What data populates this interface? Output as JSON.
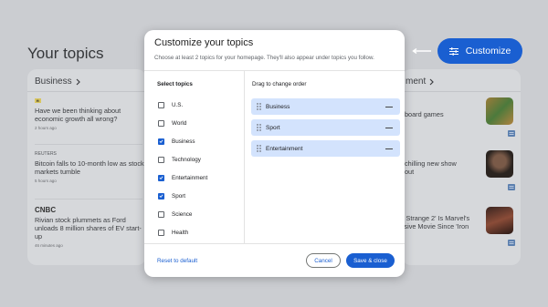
{
  "background": {
    "section_title": "Your topics",
    "left_card": {
      "header": "Business",
      "stories": [
        {
          "source": "ft",
          "title": "Have we been thinking about economic growth all wrong?",
          "time": "2 hours ago"
        },
        {
          "source": "REUTERS",
          "title": "Bitcoin falls to 10-month low as stock markets tumble",
          "time": "5 hours ago"
        },
        {
          "source": "CNBC",
          "title": "Rivian stock plummets as Ford unloads 8 million shares of EV start-up",
          "time": "46 minutes ago"
        }
      ]
    },
    "right_card": {
      "header": "ment",
      "stories": [
        {
          "text": "board games"
        },
        {
          "text": "chilling new show\nout"
        },
        {
          "text": "r Strange 2' Is Marvel's\nrsive Movie Since 'Iron"
        }
      ]
    },
    "customize_label": "Customize"
  },
  "dialog": {
    "title": "Customize your topics",
    "subtitle": "Choose at least 2 topics for your homepage. They'll also appear under topics you follow.",
    "select_heading": "Select topics",
    "order_heading": "Drag to change order",
    "topics": [
      {
        "label": "U.S.",
        "checked": false
      },
      {
        "label": "World",
        "checked": false
      },
      {
        "label": "Business",
        "checked": true
      },
      {
        "label": "Technology",
        "checked": false
      },
      {
        "label": "Entertainment",
        "checked": true
      },
      {
        "label": "Sport",
        "checked": true
      },
      {
        "label": "Science",
        "checked": false
      },
      {
        "label": "Health",
        "checked": false
      }
    ],
    "order": [
      "Business",
      "Sport",
      "Entertainment"
    ],
    "reset_label": "Reset to default",
    "cancel_label": "Cancel",
    "save_label": "Save & close"
  },
  "colors": {
    "accent": "#1a5fd1",
    "order_bg": "#d3e3fd"
  }
}
